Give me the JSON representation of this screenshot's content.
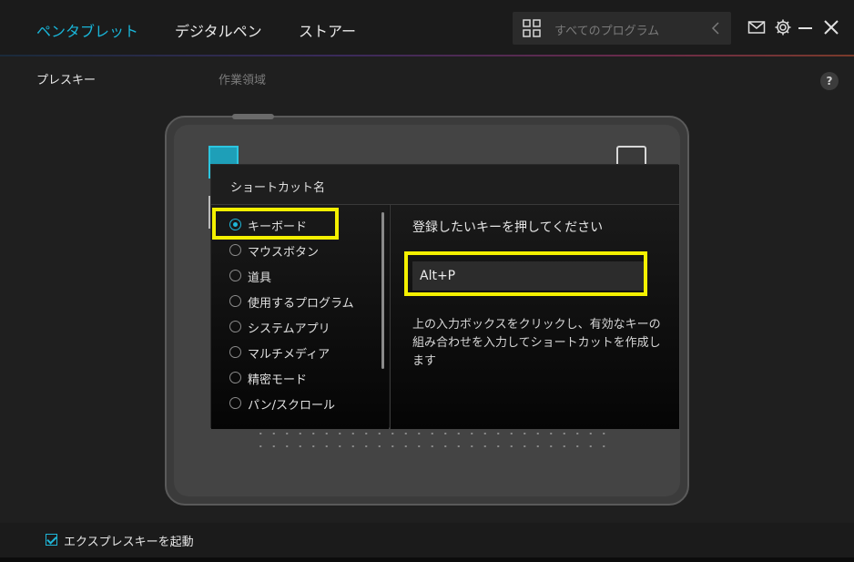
{
  "nav": {
    "tabs": [
      {
        "label": "ペンタブレット",
        "active": true
      },
      {
        "label": "デジタルペン",
        "active": false
      },
      {
        "label": "ストアー",
        "active": false
      }
    ]
  },
  "program_select": {
    "placeholder": "すべてのプログラム",
    "icon": "grid-icon"
  },
  "window_icons": [
    "mail-icon",
    "gear-icon",
    "minimize-icon",
    "close-icon"
  ],
  "subtabs": [
    {
      "label": "プレスキー",
      "active": true
    },
    {
      "label": "作業領域",
      "active": false
    }
  ],
  "help": {
    "label": "?"
  },
  "popup": {
    "title": "ショートカット名",
    "options": [
      {
        "label": "キーボード",
        "selected": true
      },
      {
        "label": "マウスボタン",
        "selected": false
      },
      {
        "label": "道具",
        "selected": false
      },
      {
        "label": "使用するプログラム",
        "selected": false
      },
      {
        "label": "システムアプリ",
        "selected": false
      },
      {
        "label": "マルチメディア",
        "selected": false
      },
      {
        "label": "精密モード",
        "selected": false
      },
      {
        "label": "パン/スクロール",
        "selected": false
      }
    ],
    "prompt": "登録したいキーを押してください",
    "key_value": "Alt+P",
    "hint": "上の入力ボックスをクリックし、有効なキーの組み合わせを入力してショートカットを作成します"
  },
  "footer": {
    "checkbox_label": "エクスプレスキーを起動",
    "checked": true
  },
  "colors": {
    "accent": "#19b5d8",
    "highlight": "#f4f000",
    "background": "#1f1f1f"
  }
}
